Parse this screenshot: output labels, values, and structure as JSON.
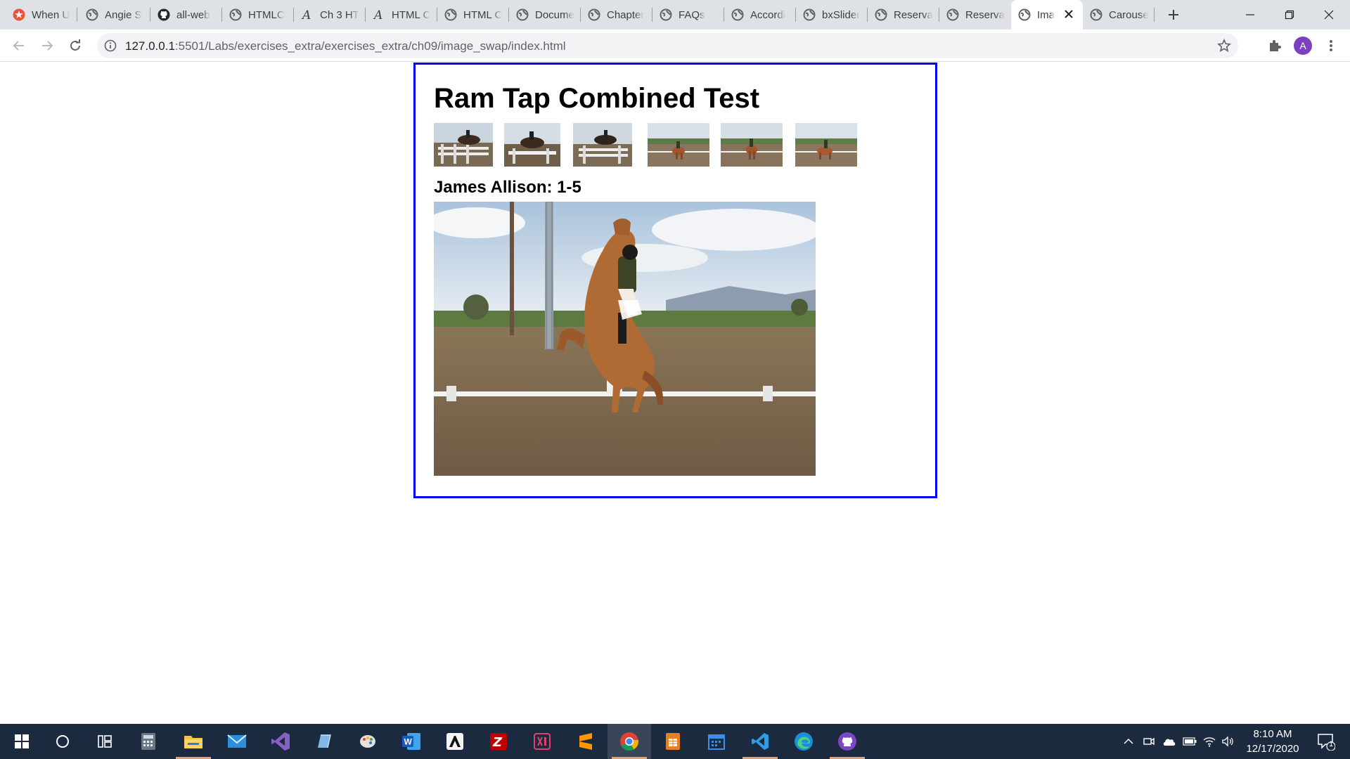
{
  "browser": {
    "tabs": [
      {
        "title": "When U",
        "favicon": "red-star-icon"
      },
      {
        "title": "Angie S",
        "favicon": "globe-icon"
      },
      {
        "title": "all-web",
        "favicon": "github-icon"
      },
      {
        "title": "HTMLC",
        "favicon": "globe-icon"
      },
      {
        "title": "Ch 3 HT",
        "favicon": "script-a-icon"
      },
      {
        "title": "HTML C",
        "favicon": "script-a-icon"
      },
      {
        "title": "HTML C",
        "favicon": "globe-icon"
      },
      {
        "title": "Docume",
        "favicon": "globe-icon"
      },
      {
        "title": "Chapter",
        "favicon": "globe-icon"
      },
      {
        "title": "FAQs",
        "favicon": "globe-icon"
      },
      {
        "title": "Accordi",
        "favicon": "globe-icon"
      },
      {
        "title": "bxSlider",
        "favicon": "globe-icon"
      },
      {
        "title": "Reserva",
        "favicon": "globe-icon"
      },
      {
        "title": "Reserva",
        "favicon": "globe-icon"
      },
      {
        "title": "Ima",
        "favicon": "globe-icon",
        "active": true
      },
      {
        "title": "Carouse",
        "favicon": "globe-icon"
      }
    ],
    "url_host": "127.0.0.1",
    "url_path": ":5501/Labs/exercises_extra/exercises_extra/ch09/image_swap/index.html",
    "profile_initial": "A",
    "accent": "#7b3fbf"
  },
  "page": {
    "title": "Ram Tap Combined Test",
    "caption": "James Allison: 1-5",
    "border_color": "#0000ee",
    "thumbnails": [
      {
        "name": "thumb-jump-1"
      },
      {
        "name": "thumb-jump-2"
      },
      {
        "name": "thumb-jump-3"
      },
      {
        "name": "thumb-dressage-1"
      },
      {
        "name": "thumb-dressage-2"
      },
      {
        "name": "thumb-dressage-3"
      }
    ]
  },
  "taskbar": {
    "time": "8:10 AM",
    "date": "12/17/2020",
    "notification_count": "1",
    "apps": [
      "start",
      "search",
      "task-view",
      "calculator",
      "file-explorer",
      "mail",
      "visual-studio",
      "notepad",
      "paint",
      "word",
      "inkscape",
      "filezilla",
      "adobe-xd",
      "sublime",
      "chrome",
      "sheets",
      "calendar",
      "vscode",
      "edge",
      "github-desktop"
    ]
  }
}
